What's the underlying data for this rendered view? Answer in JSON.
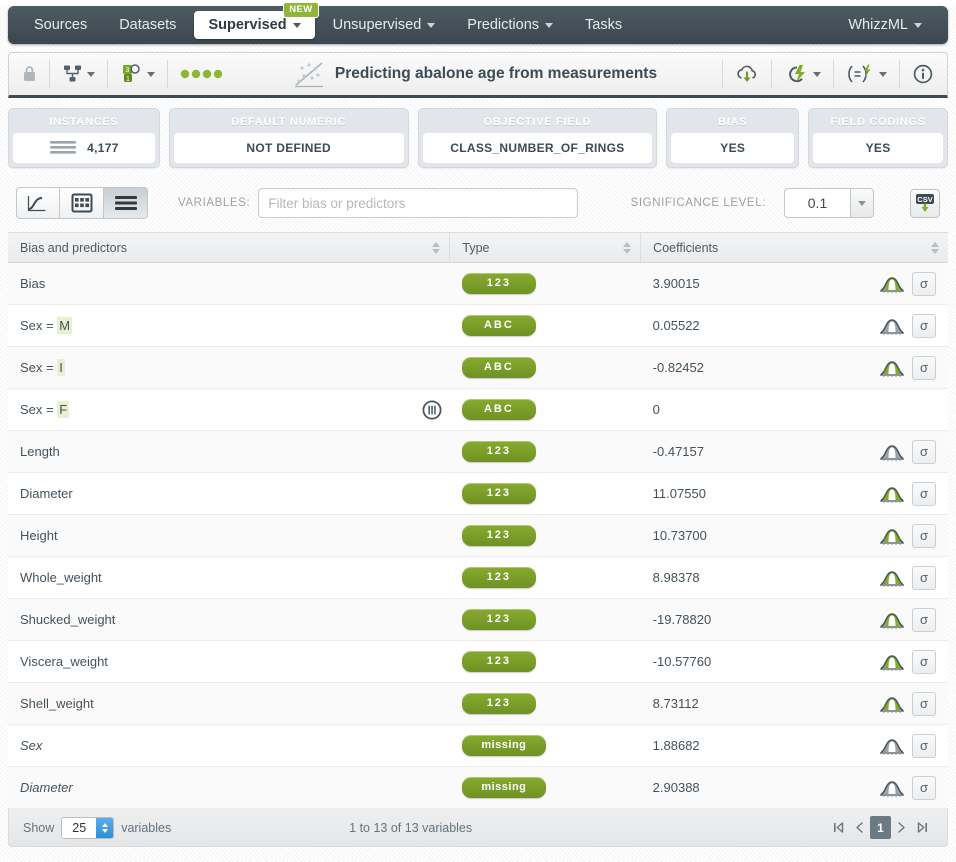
{
  "nav": {
    "items": [
      {
        "label": "Sources",
        "caret": false,
        "active": false,
        "badge": null
      },
      {
        "label": "Datasets",
        "caret": false,
        "active": false,
        "badge": null
      },
      {
        "label": "Supervised",
        "caret": true,
        "active": true,
        "badge": "NEW"
      },
      {
        "label": "Unsupervised",
        "caret": true,
        "active": false,
        "badge": null
      },
      {
        "label": "Predictions",
        "caret": true,
        "active": false,
        "badge": null
      },
      {
        "label": "Tasks",
        "caret": false,
        "active": false,
        "badge": null
      }
    ],
    "right": {
      "label": "WhizzML",
      "caret": true
    }
  },
  "resource_bar": {
    "title": "Predicting abalone age from measurements",
    "icons": {
      "lock": "lock-icon",
      "sharing": "sharing-network-icon",
      "counts": "resource-counts-icon",
      "status_dots": "status-dots-icon",
      "model_thumb": "logistic-regression-thumb-icon",
      "download": "download-cloud-icon",
      "flash": "flash-actions-icon",
      "equation": "equation-actions-icon",
      "info": "info-icon"
    }
  },
  "cards": [
    {
      "label": "INSTANCES",
      "value": "4,177",
      "icon": "instances-icon"
    },
    {
      "label": "DEFAULT NUMERIC",
      "value": "NOT DEFINED",
      "icon": null
    },
    {
      "label": "OBJECTIVE FIELD",
      "value": "CLASS_NUMBER_OF_RINGS",
      "icon": null
    },
    {
      "label": "BIAS",
      "value": "YES",
      "icon": null
    },
    {
      "label": "FIELD CODINGS",
      "value": "YES",
      "icon": null
    }
  ],
  "toolbar": {
    "views": [
      {
        "name": "chart-view",
        "icon": "curve-chart-icon",
        "active": false
      },
      {
        "name": "grid-view",
        "icon": "grid-icon",
        "active": false
      },
      {
        "name": "list-view",
        "icon": "list-icon",
        "active": true
      }
    ],
    "variables_label": "VARIABLES:",
    "filter_placeholder": "Filter bias or predictors",
    "filter_value": "",
    "significance_label": "SIGNIFICANCE LEVEL:",
    "significance_value": "0.1",
    "csv_label": "CSV"
  },
  "table": {
    "headers": [
      "Bias and predictors",
      "Type",
      "Coefficients",
      ""
    ],
    "rows": [
      {
        "name": "Bias",
        "highlight": null,
        "type": "123",
        "coefficient": "3.90015",
        "significant": true,
        "reference": false,
        "missing": false,
        "actions": true
      },
      {
        "name": "Sex = ",
        "highlight": "M",
        "type": "ABC",
        "coefficient": "0.05522",
        "significant": false,
        "reference": false,
        "missing": false,
        "actions": true
      },
      {
        "name": "Sex = ",
        "highlight": "I",
        "type": "ABC",
        "coefficient": "-0.82452",
        "significant": true,
        "reference": false,
        "missing": false,
        "actions": true
      },
      {
        "name": "Sex = ",
        "highlight": "F",
        "type": "ABC",
        "coefficient": "0",
        "significant": false,
        "reference": true,
        "missing": false,
        "actions": false
      },
      {
        "name": "Length",
        "highlight": null,
        "type": "123",
        "coefficient": "-0.47157",
        "significant": false,
        "reference": false,
        "missing": false,
        "actions": true
      },
      {
        "name": "Diameter",
        "highlight": null,
        "type": "123",
        "coefficient": "11.07550",
        "significant": true,
        "reference": false,
        "missing": false,
        "actions": true
      },
      {
        "name": "Height",
        "highlight": null,
        "type": "123",
        "coefficient": "10.73700",
        "significant": true,
        "reference": false,
        "missing": false,
        "actions": true
      },
      {
        "name": "Whole_weight",
        "highlight": null,
        "type": "123",
        "coefficient": "8.98378",
        "significant": true,
        "reference": false,
        "missing": false,
        "actions": true
      },
      {
        "name": "Shucked_weight",
        "highlight": null,
        "type": "123",
        "coefficient": "-19.78820",
        "significant": true,
        "reference": false,
        "missing": false,
        "actions": true
      },
      {
        "name": "Viscera_weight",
        "highlight": null,
        "type": "123",
        "coefficient": "-10.57760",
        "significant": true,
        "reference": false,
        "missing": false,
        "actions": true
      },
      {
        "name": "Shell_weight",
        "highlight": null,
        "type": "123",
        "coefficient": "8.73112",
        "significant": true,
        "reference": false,
        "missing": false,
        "actions": true
      },
      {
        "name": "Sex",
        "highlight": null,
        "type": "missing",
        "coefficient": "1.88682",
        "significant": false,
        "reference": false,
        "missing": true,
        "actions": true
      },
      {
        "name": "Diameter",
        "highlight": null,
        "type": "missing",
        "coefficient": "2.90388",
        "significant": false,
        "reference": false,
        "missing": true,
        "actions": true
      }
    ]
  },
  "footer": {
    "show_label": "Show",
    "show_value": "25",
    "show_suffix": "variables",
    "rowcount": "1 to 13 of 13 variables",
    "pager": {
      "first": "first-page-icon",
      "prev": "prev-page-icon",
      "current": "1",
      "next": "next-page-icon",
      "last": "last-page-icon"
    }
  },
  "colors": {
    "nav_bg": "#3b474e",
    "accent_green": "#7da32a",
    "badge_green": "#8fb636",
    "highlight": "#e8f0cf",
    "pager_active": "#6c7a84"
  }
}
